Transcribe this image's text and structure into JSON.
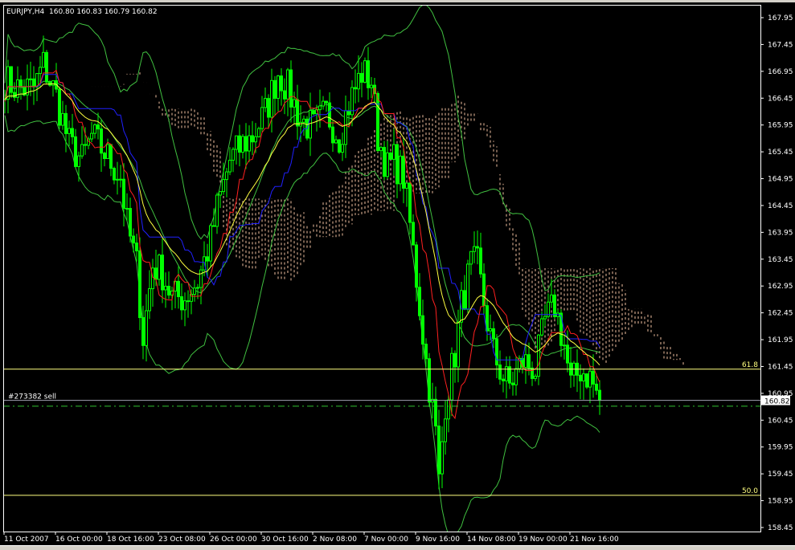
{
  "window": {
    "symbol_period": "EURJPY,H4",
    "ohlc": "160.80 160.83 160.79 160.82"
  },
  "chart_data": {
    "type": "candlestick",
    "symbol": "EURJPY",
    "timeframe": "H4",
    "ylim": [
      158.2,
      168.2
    ],
    "price_ticks": [
      "167.95",
      "167.45",
      "166.95",
      "166.45",
      "165.95",
      "165.45",
      "164.95",
      "164.45",
      "163.95",
      "163.45",
      "162.95",
      "162.45",
      "161.95",
      "161.45",
      "160.95",
      "160.45",
      "159.95",
      "159.45",
      "158.95",
      "158.45"
    ],
    "time_labels": [
      "11 Oct 2007",
      "16 Oct 00:00",
      "18 Oct 16:00",
      "23 Oct 08:00",
      "26 Oct 00:00",
      "30 Oct 16:00",
      "2 Nov 08:00",
      "7 Nov 00:00",
      "9 Nov 16:00",
      "14 Nov 08:00",
      "19 Nov 00:00",
      "21 Nov 16:00"
    ],
    "bars_per_label": 16,
    "bar_count": 186,
    "close_keypoints": [
      [
        0,
        166.78
      ],
      [
        4,
        166.63
      ],
      [
        9,
        166.63
      ],
      [
        12,
        167.08
      ],
      [
        16,
        166.48
      ],
      [
        20,
        165.59
      ],
      [
        24,
        165.29
      ],
      [
        27,
        165.74
      ],
      [
        31,
        165.44
      ],
      [
        36,
        164.99
      ],
      [
        38,
        164.09
      ],
      [
        41,
        163.34
      ],
      [
        43,
        162.0
      ],
      [
        46,
        163.34
      ],
      [
        49,
        163.19
      ],
      [
        52,
        162.74
      ],
      [
        56,
        162.74
      ],
      [
        60,
        163.04
      ],
      [
        64,
        163.79
      ],
      [
        66,
        164.39
      ],
      [
        70,
        165.29
      ],
      [
        74,
        165.59
      ],
      [
        77,
        165.74
      ],
      [
        81,
        166.18
      ],
      [
        85,
        166.93
      ],
      [
        88,
        166.63
      ],
      [
        92,
        166.03
      ],
      [
        96,
        165.89
      ],
      [
        100,
        166.18
      ],
      [
        104,
        165.74
      ],
      [
        107,
        166.33
      ],
      [
        111,
        166.93
      ],
      [
        114,
        166.78
      ],
      [
        116,
        165.74
      ],
      [
        119,
        165.14
      ],
      [
        121,
        165.29
      ],
      [
        124,
        164.99
      ],
      [
        126,
        164.09
      ],
      [
        129,
        162.59
      ],
      [
        131,
        161.55
      ],
      [
        134,
        160.2
      ],
      [
        135,
        159.3
      ],
      [
        137,
        160.8
      ],
      [
        140,
        161.7
      ],
      [
        142,
        162.59
      ],
      [
        145,
        163.34
      ],
      [
        147,
        163.34
      ],
      [
        150,
        162.29
      ],
      [
        152,
        161.7
      ],
      [
        155,
        161.25
      ],
      [
        157,
        161.1
      ],
      [
        161,
        161.55
      ],
      [
        165,
        161.4
      ],
      [
        168,
        162.29
      ],
      [
        171,
        162.59
      ],
      [
        174,
        161.85
      ],
      [
        176,
        161.1
      ],
      [
        179,
        161.4
      ],
      [
        182,
        161.25
      ],
      [
        185,
        160.82
      ]
    ],
    "current_price": "160.82",
    "levels": [
      {
        "name": "fibo-61.8",
        "label": "61.8",
        "price": 161.4,
        "color": "#ffff80"
      },
      {
        "name": "fibo-50.0",
        "label": "50.0",
        "price": 159.05,
        "color": "#ffff80"
      }
    ],
    "order_line": {
      "label": "#273382 sell",
      "price": 160.82,
      "color": "#a0a0b0"
    },
    "stop_line": {
      "price": 160.71,
      "color": "#30c030"
    },
    "indicators": {
      "tenkan_period": 9,
      "kijun_period": 26,
      "senkou_b_period": 52,
      "ma_period": 21,
      "bands_period": 20,
      "bands_dev": 2
    },
    "colors": {
      "candle": "#00ff00",
      "tenkan": "#ff2020",
      "kijun": "#2020ff",
      "ma": "#ffff40",
      "bands": "#40c040",
      "cloud": "#f0c0a0",
      "axis": "#ffffff"
    }
  }
}
